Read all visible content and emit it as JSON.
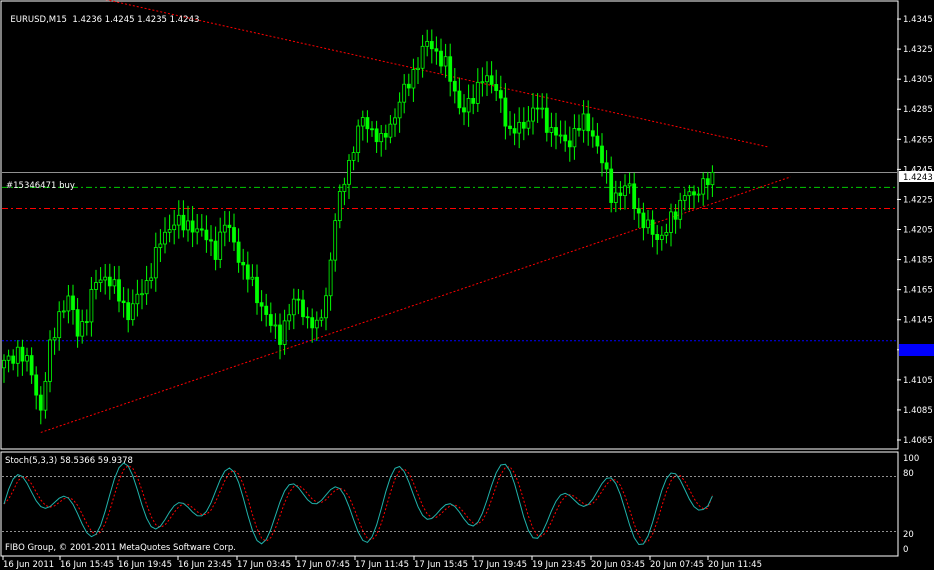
{
  "header": {
    "symbol": "EURUSD,M15",
    "ohlc": "1.4236 1.4245 1.4235 1.4243"
  },
  "order_label": "#15346471 buy",
  "current_price": "1.4243",
  "indicator": {
    "label": "Stoch(5,3,3) 58.5366 59.9378",
    "levels": [
      "100",
      "80",
      "20",
      "0"
    ]
  },
  "copyright": "FIBO Group, © 2001-2011 MetaQuotes Software Corp.",
  "colors": {
    "background": "#000000",
    "candle": "#00ff00",
    "trendline": "#ff0000",
    "order_line": "#00cc00",
    "stop_line": "#ff0000",
    "blue_line": "#0000ff",
    "price_tag": "#ffffff",
    "blue_tag": "#0000ff",
    "stoch_main": "#20b2aa",
    "stoch_signal": "#ff0000"
  },
  "chart_data": {
    "type": "candlestick",
    "symbol": "EURUSD",
    "timeframe": "M15",
    "y_ticks": [
      "1.4345",
      "1.4325",
      "1.4305",
      "1.4285",
      "1.4265",
      "1.4245",
      "1.4225",
      "1.4205",
      "1.4185",
      "1.4165",
      "1.4145",
      "1.4125",
      "1.4105",
      "1.4085",
      "1.4065"
    ],
    "y_range": [
      1.4059,
      1.4357
    ],
    "x_ticks": [
      "16 Jun 2011",
      "16 Jun 15:45",
      "16 Jun 19:45",
      "16 Jun 23:45",
      "17 Jun 03:45",
      "17 Jun 07:45",
      "17 Jun 11:45",
      "17 Jun 15:45",
      "17 Jun 19:45",
      "19 Jun 23:45",
      "20 Jun 03:45",
      "20 Jun 07:45",
      "20 Jun 11:45"
    ],
    "levels": {
      "current": 1.4243,
      "order_buy": 1.4233,
      "stop": 1.4219,
      "blue": 1.4131
    },
    "close_path": [
      [
        0,
        1.4115
      ],
      [
        3,
        1.4125
      ],
      [
        6,
        1.411
      ],
      [
        8,
        1.4085
      ],
      [
        10,
        1.4125
      ],
      [
        12,
        1.415
      ],
      [
        14,
        1.4158
      ],
      [
        16,
        1.4138
      ],
      [
        18,
        1.4148
      ],
      [
        20,
        1.417
      ],
      [
        22,
        1.4175
      ],
      [
        25,
        1.416
      ],
      [
        27,
        1.415
      ],
      [
        29,
        1.4158
      ],
      [
        31,
        1.417
      ],
      [
        33,
        1.4188
      ],
      [
        35,
        1.4202
      ],
      [
        37,
        1.4212
      ],
      [
        39,
        1.4206
      ],
      [
        41,
        1.4209
      ],
      [
        44,
        1.4198
      ],
      [
        46,
        1.4192
      ],
      [
        48,
        1.4208
      ],
      [
        50,
        1.4198
      ],
      [
        52,
        1.4178
      ],
      [
        54,
        1.4168
      ],
      [
        56,
        1.4155
      ],
      [
        58,
        1.414
      ],
      [
        60,
        1.4135
      ],
      [
        62,
        1.415
      ],
      [
        64,
        1.4158
      ],
      [
        66,
        1.4145
      ],
      [
        68,
        1.4138
      ],
      [
        70,
        1.4162
      ],
      [
        72,
        1.421
      ],
      [
        74,
        1.424
      ],
      [
        76,
        1.426
      ],
      [
        78,
        1.4278
      ],
      [
        80,
        1.4272
      ],
      [
        82,
        1.4262
      ],
      [
        84,
        1.4275
      ],
      [
        86,
        1.429
      ],
      [
        88,
        1.4302
      ],
      [
        90,
        1.4318
      ],
      [
        92,
        1.4328
      ],
      [
        94,
        1.4324
      ],
      [
        96,
        1.4314
      ],
      [
        98,
        1.4295
      ],
      [
        100,
        1.4285
      ],
      [
        102,
        1.429
      ],
      [
        104,
        1.431
      ],
      [
        106,
        1.43
      ],
      [
        108,
        1.4292
      ],
      [
        110,
        1.4268
      ],
      [
        112,
        1.4272
      ],
      [
        114,
        1.428
      ],
      [
        116,
        1.4286
      ],
      [
        118,
        1.4276
      ],
      [
        120,
        1.4268
      ],
      [
        122,
        1.4262
      ],
      [
        124,
        1.427
      ],
      [
        126,
        1.4276
      ],
      [
        128,
        1.427
      ],
      [
        130,
        1.425
      ],
      [
        132,
        1.4228
      ],
      [
        134,
        1.423
      ],
      [
        136,
        1.4232
      ],
      [
        138,
        1.4215
      ],
      [
        140,
        1.4205
      ],
      [
        142,
        1.42
      ],
      [
        144,
        1.4205
      ],
      [
        146,
        1.4215
      ],
      [
        148,
        1.4232
      ],
      [
        150,
        1.4224
      ],
      [
        152,
        1.4238
      ],
      [
        154,
        1.4243
      ]
    ],
    "trendlines": [
      {
        "name": "upper",
        "from": [
          1.4373,
          0
        ],
        "to": [
          1.426,
          166
        ]
      },
      {
        "name": "lower",
        "from": [
          1.407,
          8
        ],
        "to": [
          1.424,
          171
        ]
      }
    ],
    "stoch": {
      "params": "5,3,3",
      "main": 58.5366,
      "signal": 59.9378,
      "levels": [
        80,
        20
      ],
      "range": [
        0,
        100
      ]
    }
  }
}
